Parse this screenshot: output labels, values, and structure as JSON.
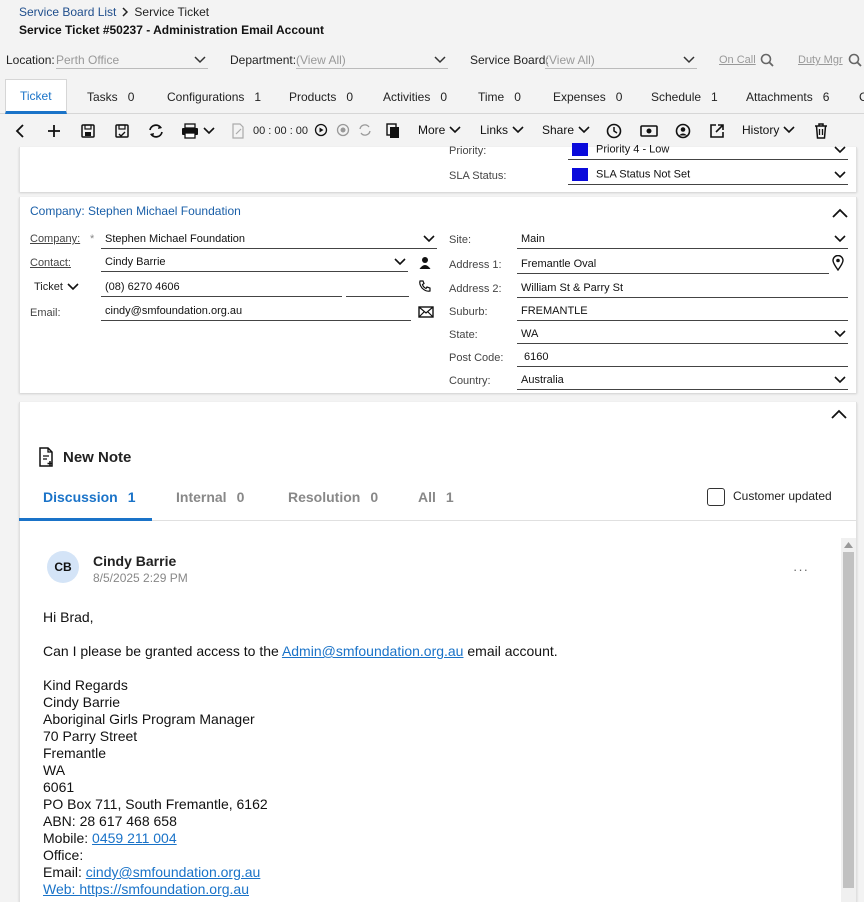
{
  "breadcrumb": {
    "parent": "Service Board List",
    "current": "Service Ticket"
  },
  "page_title": "Service Ticket #50237 - Administration Email Account",
  "filters": {
    "location_label": "Location:",
    "location_value": "Perth Office",
    "department_label": "Department:",
    "department_value": "(View All)",
    "board_label": "Service Board:",
    "board_value": "(View All)",
    "on_call": "On Call",
    "duty_mgr": "Duty Mgr"
  },
  "tabs": [
    {
      "label": "Ticket",
      "count": ""
    },
    {
      "label": "Tasks",
      "count": "0"
    },
    {
      "label": "Configurations",
      "count": "1"
    },
    {
      "label": "Products",
      "count": "0"
    },
    {
      "label": "Activities",
      "count": "0"
    },
    {
      "label": "Time",
      "count": "0"
    },
    {
      "label": "Expenses",
      "count": "0"
    },
    {
      "label": "Schedule",
      "count": "1"
    },
    {
      "label": "Attachments",
      "count": "6"
    },
    {
      "label": "C",
      "count": ""
    }
  ],
  "toolbar": {
    "timer": "00 : 00 : 00",
    "more": "More",
    "links": "Links",
    "share": "Share",
    "history": "History"
  },
  "status_panel": {
    "priority_label": "Priority:",
    "priority_value": "Priority 4 - Low",
    "sla_label": "SLA Status:",
    "sla_value": "SLA Status Not Set",
    "swatch_color": "#0a0adb"
  },
  "company_panel": {
    "header": "Company: Stephen Michael Foundation",
    "company_label": "Company:",
    "company_value": "Stephen Michael Foundation",
    "contact_label": "Contact:",
    "contact_value": "Cindy Barrie",
    "phone_type": "Ticket",
    "phone_value": "(08) 6270 4606",
    "email_label": "Email:",
    "email_value": "cindy@smfoundation.org.au",
    "site_label": "Site:",
    "site_value": "Main",
    "address1_label": "Address 1:",
    "address1_value": "Fremantle Oval",
    "address2_label": "Address 2:",
    "address2_value": "William St & Parry St",
    "suburb_label": "Suburb:",
    "suburb_value": "FREMANTLE",
    "state_label": "State:",
    "state_value": "WA",
    "postcode_label": "Post Code:",
    "postcode_value": "6160",
    "country_label": "Country:",
    "country_value": "Australia"
  },
  "notes": {
    "new_note": "New Note",
    "tabs": [
      {
        "label": "Discussion",
        "count": "1"
      },
      {
        "label": "Internal",
        "count": "0"
      },
      {
        "label": "Resolution",
        "count": "0"
      },
      {
        "label": "All",
        "count": "1"
      }
    ],
    "customer_updated": "Customer updated"
  },
  "message": {
    "initials": "CB",
    "author": "Cindy Barrie",
    "timestamp": "8/5/2025 2:29 PM",
    "greeting": "Hi Brad,",
    "body_pre": "Can I please be granted access to the ",
    "body_link": "Admin@smfoundation.org.au",
    "body_post": " email account.",
    "sig": [
      "Kind Regards",
      "Cindy Barrie",
      "Aboriginal Girls Program Manager",
      "70 Parry Street",
      "Fremantle",
      "WA",
      "6061",
      "PO Box 711, South Fremantle, 6162",
      "ABN: 28 617 468 658"
    ],
    "mobile_label": "Mobile: ",
    "mobile_value": "0459 211 004",
    "office_label": "Office:",
    "email_label": "Email: ",
    "email_value": "cindy@smfoundation.org.au",
    "web_label": "Web: https://smfoundation.org.au"
  }
}
